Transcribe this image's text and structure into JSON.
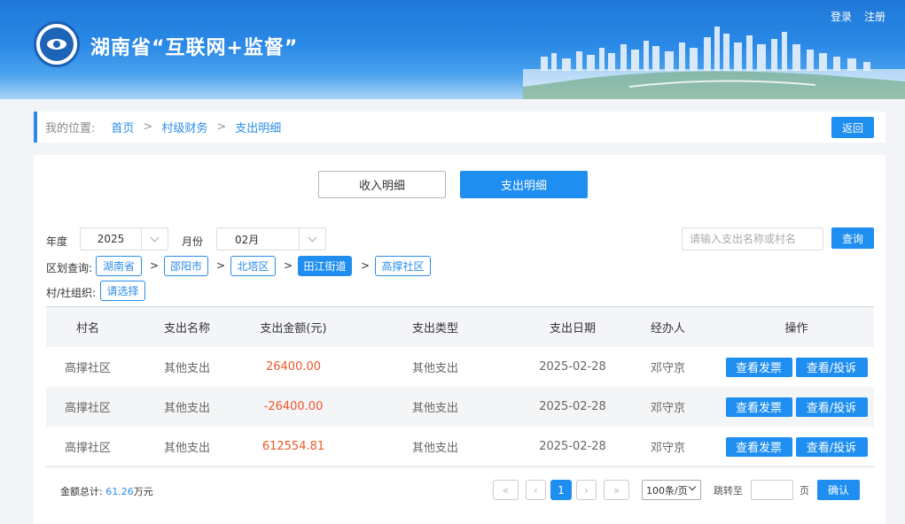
{
  "header": {
    "title": "湖南省“互联网+监督”",
    "login": "登录",
    "register": "注册"
  },
  "breadcrumb": {
    "label": "我的位置:",
    "items": [
      "首页",
      "村级财务",
      "支出明细"
    ],
    "separator": ">",
    "back": "返回"
  },
  "tabs": [
    {
      "label": "收入明细",
      "active": false
    },
    {
      "label": "支出明细",
      "active": true
    }
  ],
  "filters": {
    "year_label": "年度",
    "year_value": "2025",
    "month_label": "月份",
    "month_value": "02月",
    "search_placeholder": "请输入支出名称或村名",
    "query": "查询",
    "region_label": "区划查询:",
    "regions": [
      "湖南省",
      "邵阳市",
      "北塔区",
      "田江街道",
      "高撑社区"
    ],
    "region_active_index": 3,
    "org_label": "村/社组织:",
    "org_value": "请选择"
  },
  "table": {
    "headers": [
      "村名",
      "支出名称",
      "支出金额(元)",
      "支出类型",
      "支出日期",
      "经办人",
      "操作"
    ],
    "rows": [
      {
        "village": "高撑社区",
        "name": "其他支出",
        "amount": "26400.00",
        "type": "其他支出",
        "date": "2025-02-28",
        "handler": "邓守京"
      },
      {
        "village": "高撑社区",
        "name": "其他支出",
        "amount": "-26400.00",
        "type": "其他支出",
        "date": "2025-02-28",
        "handler": "邓守京"
      },
      {
        "village": "高撑社区",
        "name": "其他支出",
        "amount": "612554.81",
        "type": "其他支出",
        "date": "2025-02-28",
        "handler": "邓守京"
      }
    ],
    "op_invoice": "查看发票",
    "op_complaint": "查看/投诉"
  },
  "footer": {
    "total_label": "金额总计:",
    "total_value": "61.26",
    "total_unit": "万元",
    "current_page": "1",
    "page_size": "100条/页",
    "jump_label": "跳转至",
    "page_label": "页",
    "confirm": "确认"
  },
  "colors": {
    "accent": "#1e8ef0",
    "amount": "#f0582b"
  }
}
